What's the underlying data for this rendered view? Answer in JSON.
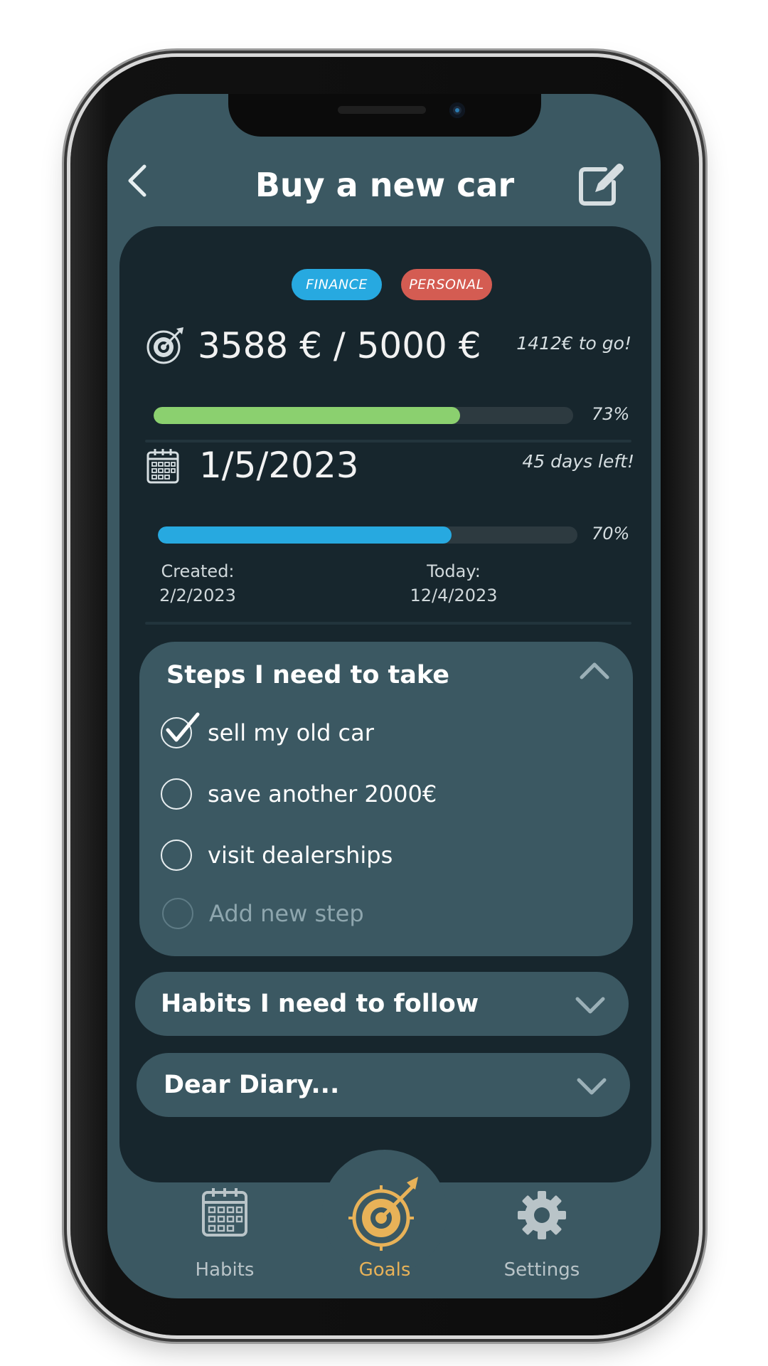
{
  "header": {
    "title": "Buy a new car"
  },
  "tags": [
    {
      "label": "FINANCE",
      "color": "#27a9e0"
    },
    {
      "label": "PERSONAL",
      "color": "#d45c52"
    }
  ],
  "savings": {
    "current": "3588 € / 5000 €",
    "remaining": "1412€ to go!",
    "progress_label": "73%",
    "progress": 0.73,
    "bar_color": "#8bd06f"
  },
  "deadline": {
    "date": "1/5/2023",
    "remaining": "45 days left!",
    "progress_label": "70%",
    "progress": 0.7,
    "bar_color": "#27a9e0",
    "created_label": "Created:",
    "created_date": "2/2/2023",
    "today_label": "Today:",
    "today_date": "12/4/2023"
  },
  "steps_section": {
    "title": "Steps I need to take",
    "steps": [
      {
        "label": "sell my old car",
        "done": true
      },
      {
        "label": "save another 2000€",
        "done": false
      },
      {
        "label": "visit dealerships",
        "done": false
      }
    ],
    "add_placeholder": "Add new step"
  },
  "habits_section": {
    "title": "Habits I need to follow"
  },
  "diary_section": {
    "title": "Dear Diary..."
  },
  "nav": {
    "habits": "Habits",
    "goals": "Goals",
    "settings": "Settings",
    "active": "goals",
    "active_color": "#e8b258"
  },
  "icons": {
    "back": "chevron-left-icon",
    "edit": "edit-icon",
    "target": "target-icon",
    "calendar": "calendar-icon",
    "check": "checkmark-icon",
    "collapse": "chevron-up-icon",
    "expand": "chevron-down-icon",
    "settings": "gear-icon"
  }
}
